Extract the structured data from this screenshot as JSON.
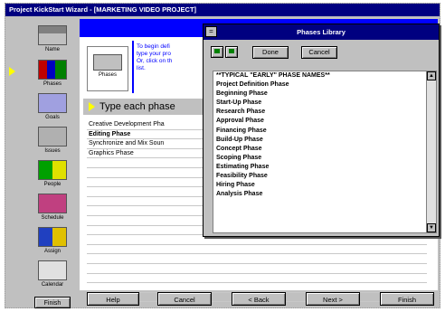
{
  "window": {
    "title": "Project KickStart Wizard - [MARKETING VIDEO PROJECT]"
  },
  "sidebar": {
    "steps": [
      {
        "label": "Name",
        "icon": "name-icon",
        "color": "#c0c0c0"
      },
      {
        "label": "Phases",
        "icon": "phases-icon",
        "color": "#c0c0c0"
      },
      {
        "label": "Goals",
        "icon": "goals-icon",
        "color": "#c0c0c0"
      },
      {
        "label": "Issues",
        "icon": "issues-icon",
        "color": "#c0c0c0"
      },
      {
        "label": "People",
        "icon": "people-icon",
        "color": "#c0c0c0"
      },
      {
        "label": "Schedule",
        "icon": "schedule-icon",
        "color": "#c0c0c0"
      },
      {
        "label": "Assign",
        "icon": "assign-icon",
        "color": "#c0c0c0"
      },
      {
        "label": "Calendar",
        "icon": "calendar-icon",
        "color": "#c0c0c0"
      }
    ],
    "finish_label": "Finish",
    "current_index": 1
  },
  "main": {
    "card_label": "Phases",
    "description_lines": [
      "To begin defi",
      "type your pro",
      "Or, click on th",
      "list."
    ],
    "prompt": "Type each phase",
    "rows": [
      "Creative Development Pha",
      "Editing Phase",
      "Synchronize and Mix Soun",
      "Graphics Phase",
      "",
      "",
      "",
      "",
      "",
      "",
      "",
      "",
      "",
      "",
      "",
      "",
      "",
      "",
      ""
    ]
  },
  "buttons": {
    "help": "Help",
    "cancel": "Cancel",
    "back": "< Back",
    "next": "Next >",
    "finish": "Finish"
  },
  "popup": {
    "title": "Phases Library",
    "sysmenu_glyph": "=",
    "done_label": "Done",
    "cancel_label": "Cancel",
    "items": [
      "**TYPICAL \"EARLY\" PHASE NAMES**",
      "Project Definition Phase",
      "Beginning Phase",
      "Start-Up Phase",
      "Research Phase",
      "Approval Phase",
      "Financing Phase",
      "Build-Up Phase",
      "Concept Phase",
      "Scoping Phase",
      "Estimating Phase",
      "Feasibility Phase",
      "Hiring Phase",
      "Analysis Phase"
    ]
  }
}
